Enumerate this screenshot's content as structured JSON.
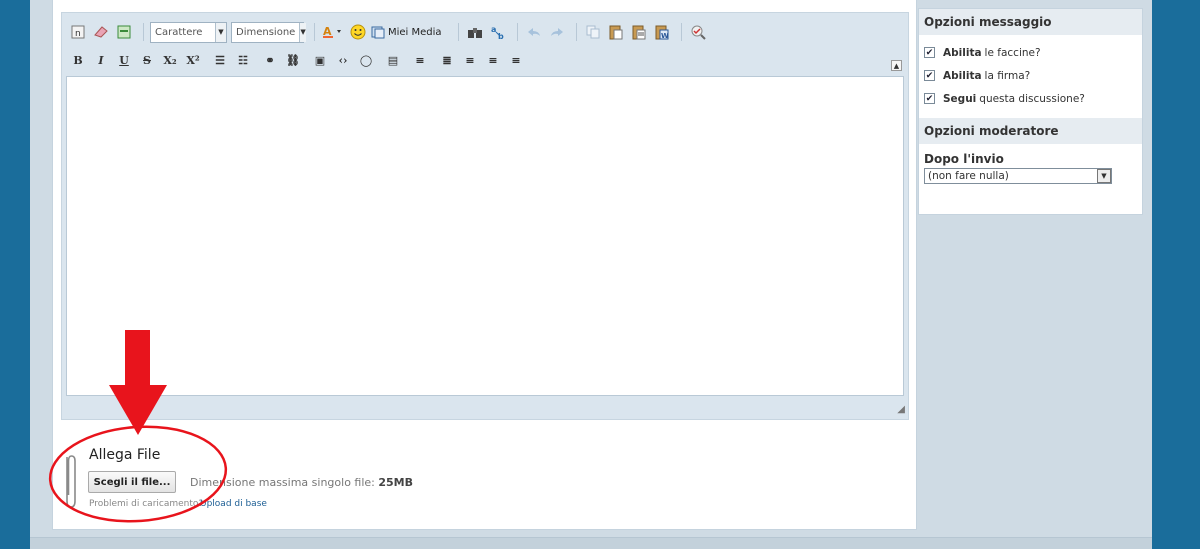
{
  "toolbar": {
    "font_label": "Carattere",
    "size_label": "Dimensione",
    "media_label": "Miei Media",
    "row1_icons": [
      "source-icon",
      "eraser-icon",
      "template-icon"
    ],
    "row1_after": [
      "undo-icon",
      "redo-icon",
      "copy-icon",
      "paste-icon",
      "paste-text-icon",
      "paste-word-icon",
      "spellcheck-icon"
    ],
    "format_buttons": [
      {
        "name": "bold-button",
        "glyph": "B"
      },
      {
        "name": "italic-button",
        "glyph": "I"
      },
      {
        "name": "underline-button",
        "glyph": "U"
      },
      {
        "name": "strike-button",
        "glyph": "S"
      },
      {
        "name": "subscript-button",
        "glyph": "X₂"
      },
      {
        "name": "superscript-button",
        "glyph": "X²"
      },
      {
        "name": "bullet-list-button",
        "glyph": "☰"
      },
      {
        "name": "numbered-list-button",
        "glyph": "☷"
      },
      {
        "name": "link-button",
        "glyph": "⚭"
      },
      {
        "name": "unlink-button",
        "glyph": "⛓"
      },
      {
        "name": "image-button",
        "glyph": "▣"
      },
      {
        "name": "code-button",
        "glyph": "‹›"
      },
      {
        "name": "quote-button",
        "glyph": "◯"
      },
      {
        "name": "table-button",
        "glyph": "▤"
      },
      {
        "name": "outdent-button",
        "glyph": "≡"
      },
      {
        "name": "indent-button",
        "glyph": "≣"
      },
      {
        "name": "align-left-button",
        "glyph": "≡"
      },
      {
        "name": "align-center-button",
        "glyph": "≡"
      },
      {
        "name": "align-right-button",
        "glyph": "≡"
      }
    ]
  },
  "attach": {
    "title": "Allega File",
    "button_label": "Scegli il file...",
    "max_size_label": "Dimensione massima singolo file:",
    "max_size_value": "25MB",
    "problems_text": "Problemi di caricamento?",
    "upload_link": "Upload di base"
  },
  "message_options": {
    "title": "Opzioni messaggio",
    "items": [
      {
        "bold": "Abilita",
        "rest": "le faccine?",
        "checked": true
      },
      {
        "bold": "Abilita",
        "rest": "la firma?",
        "checked": true
      },
      {
        "bold": "Segui",
        "rest": "questa discussione?",
        "checked": true
      }
    ]
  },
  "moderator_options": {
    "title": "Opzioni moderatore",
    "after_label": "Dopo l'invio",
    "after_value": "(non fare nulla)"
  },
  "colors": {
    "background": "#1a6d9b",
    "annotation": "#e8141c",
    "link": "#1e5f95"
  }
}
